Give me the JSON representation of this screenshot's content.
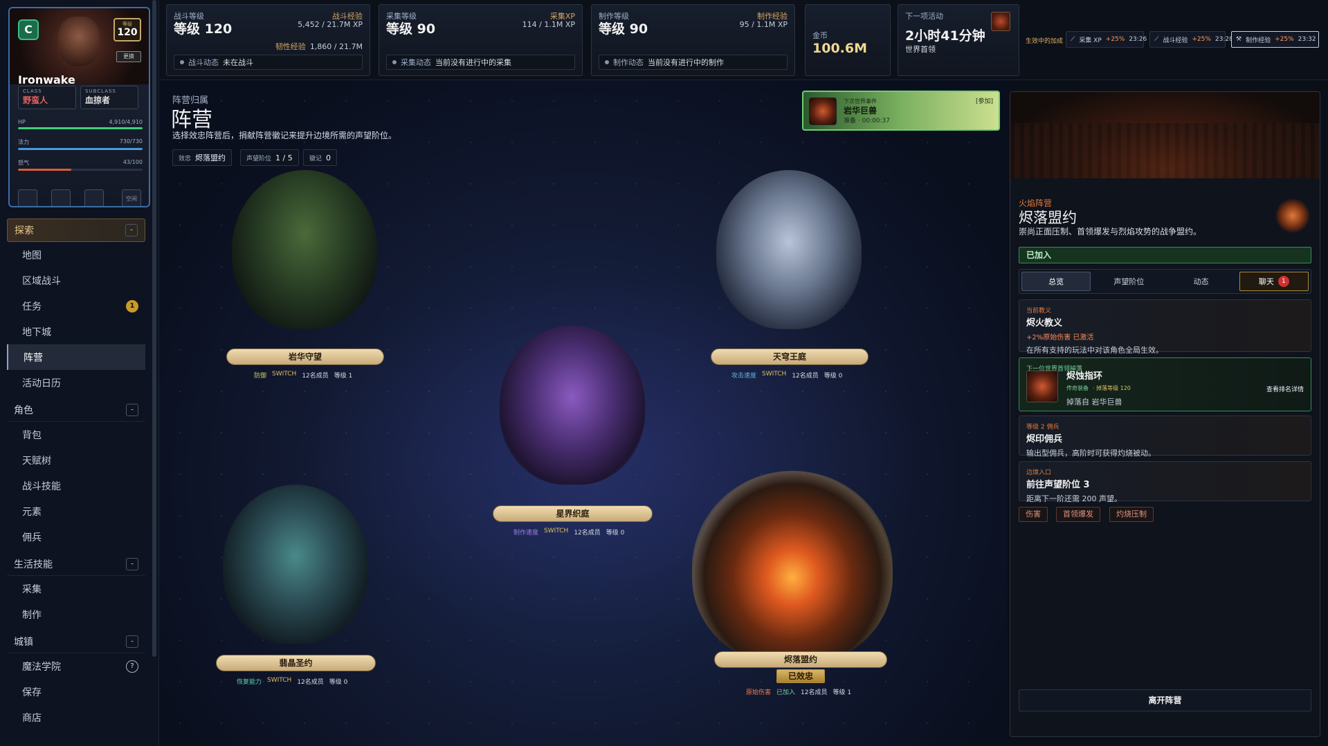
{
  "character": {
    "class_letter": "C",
    "level_label": "等级",
    "level": "120",
    "small_button": "更换",
    "name": "Ironwake",
    "class_key": "CLASS",
    "class_value": "野蛮人",
    "subclass_key": "SUBCLASS",
    "subclass_value": "血掠者",
    "hp_label": "HP",
    "hp_value": "4,910/4,910",
    "hp_fill": 1.0,
    "mana_label": "法力",
    "mana_value": "730/730",
    "mana_fill": 1.0,
    "rage_label": "怒气",
    "rage_value": "43/100",
    "rage_fill": 0.43,
    "slot_last": "空闲"
  },
  "nav": {
    "sections": [
      {
        "label": "探索",
        "toggle": "-",
        "active": true,
        "items": [
          {
            "label": "地图"
          },
          {
            "label": "区域战斗"
          },
          {
            "label": "任务",
            "badge": "1"
          },
          {
            "label": "地下城"
          },
          {
            "label": "阵营",
            "active": true
          },
          {
            "label": "活动日历"
          }
        ]
      },
      {
        "label": "角色",
        "toggle": "-",
        "items": [
          {
            "label": "背包"
          },
          {
            "label": "天赋树"
          },
          {
            "label": "战斗技能"
          },
          {
            "label": "元素"
          },
          {
            "label": "佣兵"
          }
        ]
      },
      {
        "label": "生活技能",
        "toggle": "-",
        "items": [
          {
            "label": "采集"
          },
          {
            "label": "制作"
          }
        ]
      },
      {
        "label": "城镇",
        "toggle": "-",
        "items": [
          {
            "label": "魔法学院",
            "help": "?"
          },
          {
            "label": "保存"
          },
          {
            "label": "商店"
          }
        ]
      }
    ]
  },
  "topbar": {
    "combat": {
      "title": "战斗等级",
      "level": "等级 120",
      "xp_label": "战斗经验",
      "xp_value": "5,452 / 21.7M XP",
      "tough_label": "韧性经验",
      "tough_value": "1,860 / 21.7M",
      "status_key": "战斗动态",
      "status_value": "未在战斗"
    },
    "gather": {
      "title": "采集等级",
      "level": "等级 90",
      "xp_label": "采集XP",
      "xp_value": "114 / 1.1M XP",
      "status_key": "采集动态",
      "status_value": "当前没有进行中的采集"
    },
    "craft": {
      "title": "制作等级",
      "level": "等级 90",
      "xp_label": "制作经验",
      "xp_value": "95 / 1.1M XP",
      "status_key": "制作动态",
      "status_value": "当前没有进行中的制作"
    },
    "gold": {
      "label": "金币",
      "value": "100.6M"
    },
    "next_event": {
      "label": "下一项活动",
      "time": "2小时41分钟",
      "name": "世界首领"
    },
    "buffs_label": "生效中的加成",
    "buffs": [
      {
        "name": "采集 XP",
        "bonus": "+25%",
        "time": "23:26"
      },
      {
        "name": "战斗经验",
        "bonus": "+25%",
        "time": "23:28"
      },
      {
        "name": "制作经验",
        "bonus": "+25%",
        "time": "23:32"
      }
    ]
  },
  "main": {
    "kicker": "阵营归属",
    "title": "阵营",
    "desc": "选择效忠阵营后，捐献阵营徽记来提升边境所需的声望阶位。",
    "pills": [
      {
        "key": "效忠",
        "value": "烬落盟约"
      },
      {
        "key": "声望阶位",
        "value": "1 / 5"
      },
      {
        "key": "徽记",
        "value": "0"
      }
    ],
    "event": {
      "kicker": "下次世界事件",
      "name": "岩华巨兽",
      "prep": "准备 · 00:00:37",
      "join": "[参加]"
    },
    "factions": [
      {
        "name": "岩华守望",
        "stat": "防御",
        "switch": "SWITCH",
        "members": "12名成员",
        "level": "等级 1",
        "stat_color": "#c8d060"
      },
      {
        "name": "天穹王庭",
        "stat": "攻击速度",
        "switch": "SWITCH",
        "members": "12名成员",
        "level": "等级 0",
        "stat_color": "#6ab0e0"
      },
      {
        "name": "星界织庭",
        "stat": "制作速度",
        "switch": "SWITCH",
        "members": "12名成员",
        "level": "等级 0",
        "stat_color": "#a07ae0"
      },
      {
        "name": "翡晶圣约",
        "stat": "恢复能力",
        "switch": "SWITCH",
        "members": "12名成员",
        "level": "等级 0",
        "stat_color": "#5ad0b0"
      },
      {
        "name": "烬落盟约",
        "stat": "原始伤害",
        "switch": "已加入",
        "members": "12名成员",
        "level": "等级 1",
        "stat_color": "#ff7a4a",
        "loyal": "已效忠"
      }
    ]
  },
  "panel": {
    "kicker": "火焰阵营",
    "name": "烬落盟约",
    "desc": "崇尚正面压制、首领爆发与烈焰攻势的战争盟约。",
    "joined": "已加入",
    "tabs": [
      {
        "label": "总览"
      },
      {
        "label": "声望阶位"
      },
      {
        "label": "动态"
      },
      {
        "label": "聊天",
        "count": "1"
      }
    ],
    "doctrine": {
      "kicker": "当前教义",
      "title": "烬火教义",
      "bonus": "+2%原始伤害 已激活",
      "desc": "在所有支持的玩法中对该角色全局生效。"
    },
    "boss": {
      "kicker": "下一位世界首领掉落",
      "title": "烬蚀指环",
      "rarity": "传奇装备",
      "level": "· 掉落等级 120",
      "source": "掉落自 岩华巨兽",
      "rank_btn": "查看排名详情"
    },
    "merc": {
      "kicker": "等级 2 佣兵",
      "title": "烬印佣兵",
      "desc": "输出型佣兵，高阶时可获得灼烧被动。"
    },
    "frontier": {
      "kicker": "边境入口",
      "title": "前往声望阶位 3",
      "desc": "距离下一阶还需 200 声望。"
    },
    "tags": [
      "伤害",
      "首领爆发",
      "灼烧压制"
    ],
    "leave": "离开阵营"
  },
  "colors": {
    "accent": "#d4a660",
    "hp": "#3dd07a",
    "mana": "#4a9ae0",
    "rage": "#e05a3a"
  }
}
